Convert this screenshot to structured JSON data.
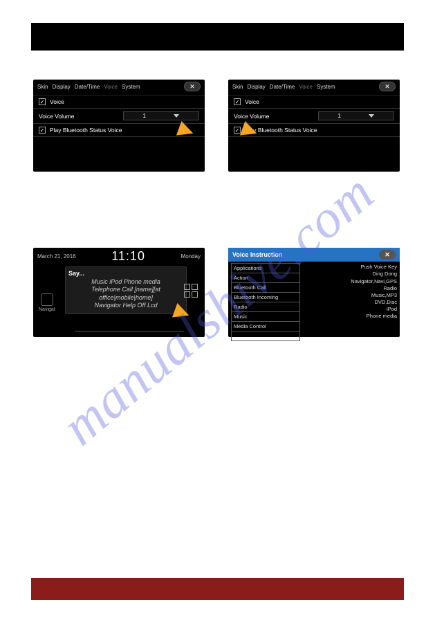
{
  "topbar": {},
  "settings": {
    "tabs": [
      "Skin",
      "Display",
      "Date/Time",
      "Voice",
      "System"
    ],
    "dim_tab": "Voice",
    "rows": {
      "voice_label": "Voice",
      "voice_volume_label": "Voice Volume",
      "voice_volume_value": "1",
      "play_bt_label": "Play Bluetooth Status Voice"
    },
    "close": "✕"
  },
  "home": {
    "date": "March 21, 2016",
    "time": "11:10",
    "day": "Monday",
    "say_title": "Say...",
    "say_body_lines": [
      "Music iPod Phone media",
      "Telephone Call [name][at",
      "office|mobile|home]",
      "Navigator Help Off Lcd"
    ],
    "nav_label": "Navigat"
  },
  "voice_instruction": {
    "title": "Voice Instruction",
    "close": "✕",
    "left": [
      "Applications",
      "Action",
      "Bluetooth Call",
      "Bluetooth Incoming",
      "Radio",
      "Music",
      "Media Control"
    ],
    "right": [
      "Push Voice Key",
      "Ding Dong",
      "",
      "Navigator,Navi,GPS",
      "Radio",
      "Music,MP3",
      "DVD,Disc",
      "iPod",
      "Phone media"
    ]
  },
  "watermark": "manualshive.com"
}
